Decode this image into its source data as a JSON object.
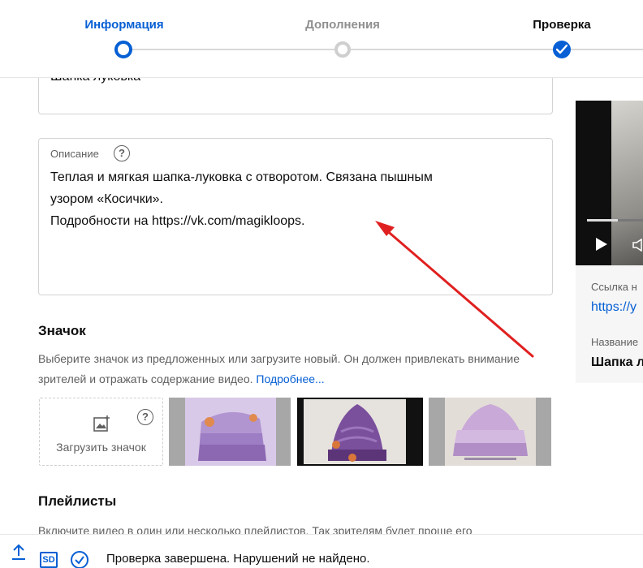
{
  "stepper": {
    "steps": [
      {
        "label": "Информация",
        "state": "current",
        "color": "#065fd4"
      },
      {
        "label": "Дополнения",
        "state": "pending",
        "color": "#909090"
      },
      {
        "label": "Проверка",
        "state": "done",
        "color": "#0d0d0d"
      }
    ]
  },
  "details": {
    "title_value": "Шапка луковка",
    "description": {
      "label": "Описание",
      "help_glyph": "?",
      "lines": [
        "Теплая и мягкая шапка-луковка с отворотом. Связана пышным",
        "узором «Косички».",
        "Подробности на https://vk.com/magikloops."
      ]
    }
  },
  "thumbnail": {
    "title": "Значок",
    "help_text": "Выберите значок из предложенных или загрузите новый. Он должен привлекать внимание зрителей и отражать содержание видео.",
    "more_link": "Подробнее...",
    "upload_label": "Загрузить значок",
    "help_glyph": "?",
    "selected_index": 1,
    "options": [
      {
        "icon": "knitted-hat-thumbnail-1"
      },
      {
        "icon": "knitted-hat-thumbnail-2"
      },
      {
        "icon": "knitted-hat-thumbnail-3"
      }
    ]
  },
  "playlists": {
    "title": "Плейлисты",
    "help_text": "Включите видео в один или несколько плейлистов. Так зрителям будет проще его"
  },
  "preview": {
    "link_label": "Ссылка н",
    "link_value": "https://y",
    "name_label": "Название",
    "name_value": "Шапка л"
  },
  "footer": {
    "icons": [
      "upload-icon",
      "sd-icon",
      "check-icon"
    ],
    "sd_text": "SD",
    "status_text": "Проверка завершена. Нарушений не найдено."
  },
  "colors": {
    "accent": "#065fd4",
    "annotation_arrow": "#e02020",
    "secondary_text": "#606060"
  }
}
